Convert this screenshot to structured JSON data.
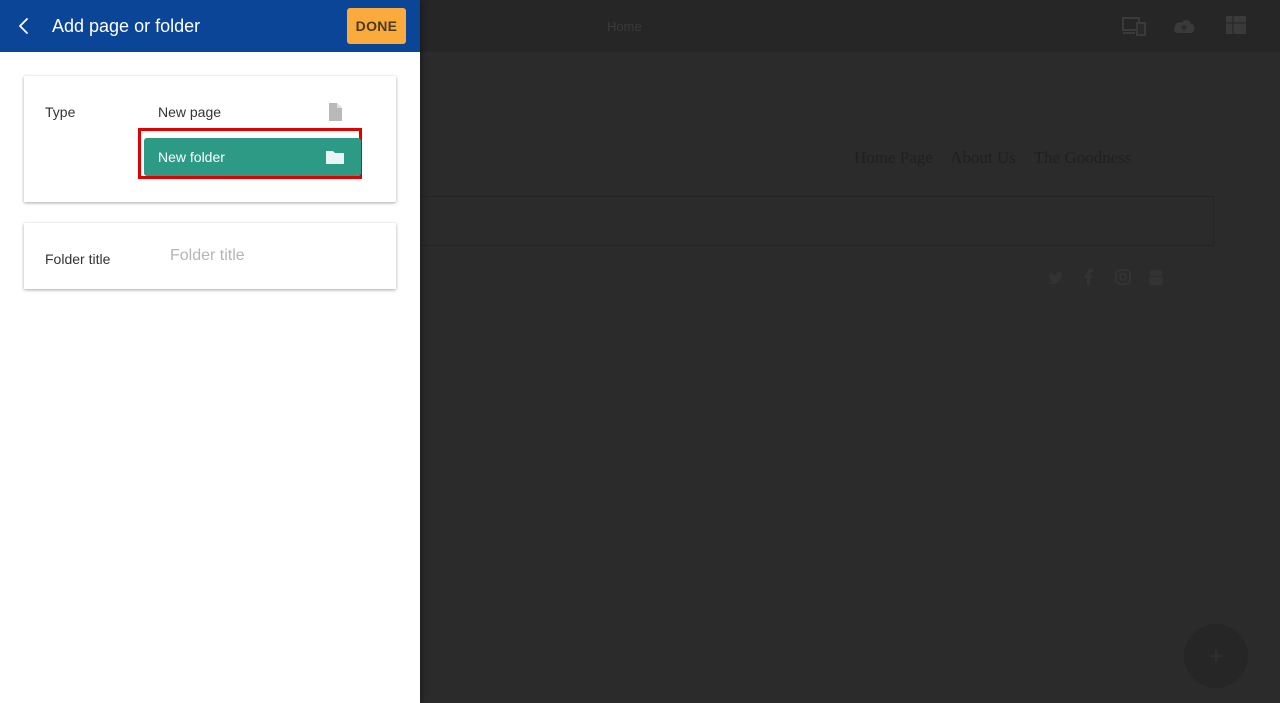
{
  "panel": {
    "title": "Add page or folder",
    "done_label": "DONE",
    "type_label": "Type",
    "options": [
      {
        "label": "New page",
        "icon": "page-icon",
        "selected": false
      },
      {
        "label": "New folder",
        "icon": "folder-icon",
        "selected": true
      }
    ],
    "folder_title_label": "Folder title",
    "folder_title_placeholder": "Folder title",
    "folder_title_value": ""
  },
  "preview": {
    "tab_label": "Home",
    "nav_items": [
      "Home Page",
      "About Us",
      "The Goodness"
    ],
    "topbar_icons": [
      "devices-icon",
      "cloud-upload-icon",
      "grid-icon"
    ],
    "social_icons": [
      "twitter-icon",
      "facebook-icon",
      "instagram-icon",
      "youtube-icon"
    ],
    "fab_symbol": "+"
  },
  "colors": {
    "header_blue": "#0a4597",
    "done_orange": "#fbaa3c",
    "selected_teal": "#2c9a85",
    "highlight_red": "#e00000",
    "overlay_dark": "#2b2b2b"
  }
}
